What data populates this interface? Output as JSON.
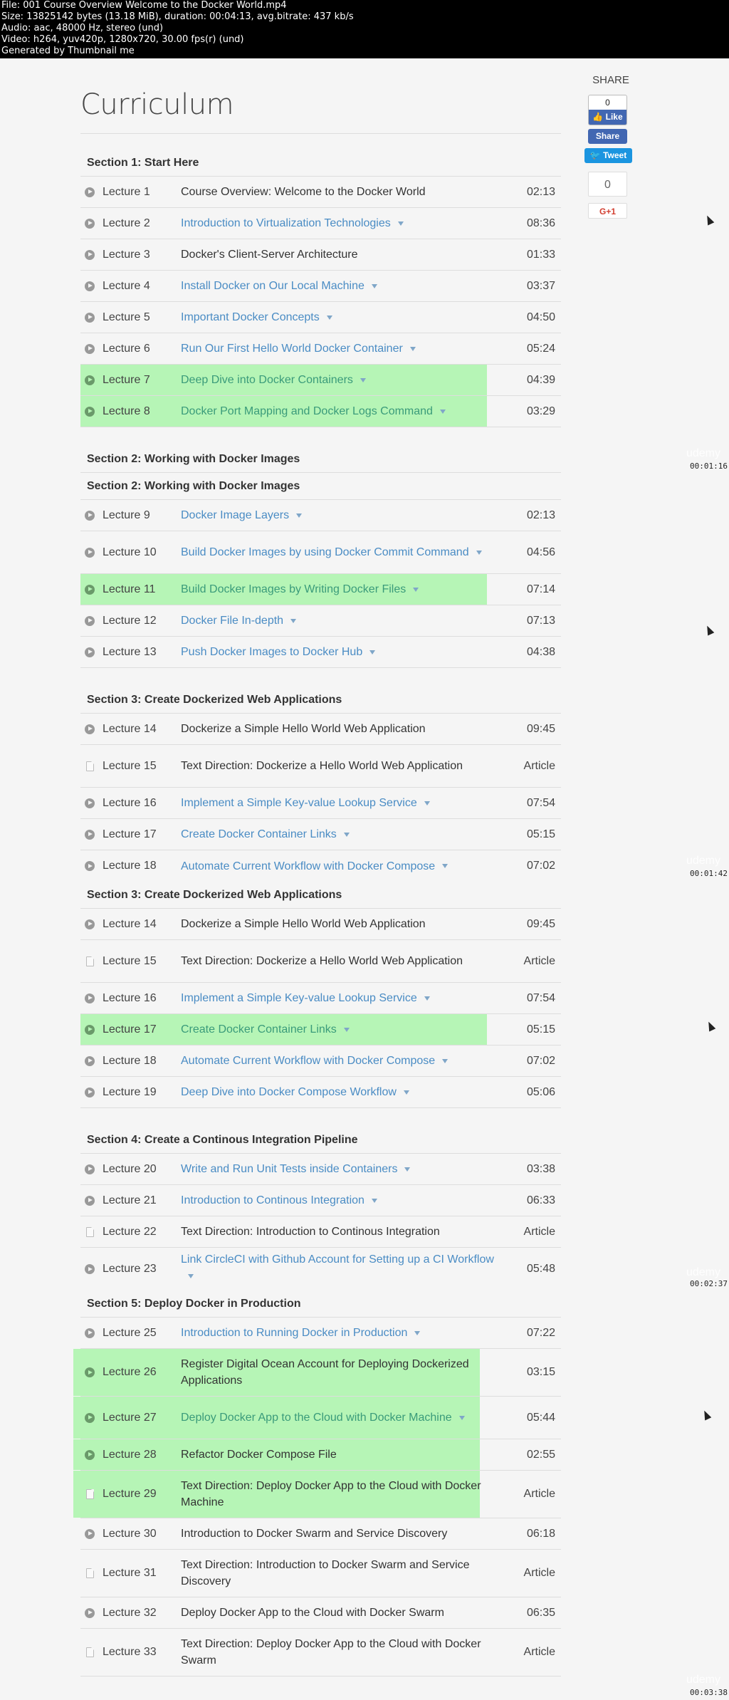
{
  "meta": {
    "lines": [
      "File: 001 Course Overview Welcome to the Docker World.mp4",
      "Size: 13825142 bytes (13.18 MiB), duration: 00:04:13, avg.bitrate: 437 kb/s",
      "Audio: aac, 48000 Hz, stereo (und)",
      "Video: h264, yuv420p, 1280x720, 30.00 fps(r) (und)",
      "Generated by Thumbnail me"
    ]
  },
  "title": "Curriculum",
  "share": {
    "label": "SHARE",
    "fb_count": "0",
    "fb_like": "Like",
    "fb_share": "Share",
    "tweet": "Tweet",
    "gplus_count": "0",
    "gplus": "G+1"
  },
  "colors": {
    "highlight": "#b6f5b6",
    "link": "#4a8cc4",
    "facebook": "#4267b2",
    "twitter": "#1b95e0",
    "gplus": "#d23f31"
  },
  "timestamps": [
    "00:01:16",
    "00:01:42",
    "00:02:37",
    "00:03:38"
  ],
  "watermark": "udemy",
  "blocks": [
    {
      "section": "Section 1: Start Here",
      "lectures": [
        {
          "num": "Lecture 1",
          "title": "Course Overview: Welcome to the Docker World",
          "dur": "02:13",
          "type": "video",
          "link": false,
          "hl": false
        },
        {
          "num": "Lecture 2",
          "title": "Introduction to Virtualization Technologies",
          "dur": "08:36",
          "type": "video",
          "link": true,
          "hl": false
        },
        {
          "num": "Lecture 3",
          "title": "Docker's Client-Server Architecture",
          "dur": "01:33",
          "type": "video",
          "link": false,
          "hl": false
        },
        {
          "num": "Lecture 4",
          "title": "Install Docker on Our Local Machine",
          "dur": "03:37",
          "type": "video",
          "link": true,
          "hl": false
        },
        {
          "num": "Lecture 5",
          "title": "Important Docker Concepts",
          "dur": "04:50",
          "type": "video",
          "link": true,
          "hl": false
        },
        {
          "num": "Lecture 6",
          "title": "Run Our First Hello World Docker Container",
          "dur": "05:24",
          "type": "video",
          "link": true,
          "hl": false
        },
        {
          "num": "Lecture 7",
          "title": "Deep Dive into Docker Containers",
          "dur": "04:39",
          "type": "video",
          "link": true,
          "hl": true
        },
        {
          "num": "Lecture 8",
          "title": "Docker Port Mapping and Docker Logs Command",
          "dur": "03:29",
          "type": "video",
          "link": true,
          "hl": true
        }
      ]
    },
    {
      "section": "Section 2: Working with Docker Images",
      "gap": true,
      "lectures": []
    },
    {
      "section": "Section 2: Working with Docker Images",
      "lectures": [
        {
          "num": "Lecture 9",
          "title": "Docker Image Layers",
          "dur": "02:13",
          "type": "video",
          "link": true,
          "hl": false
        },
        {
          "num": "Lecture 10",
          "title": "Build Docker Images by using Docker Commit Command",
          "dur": "04:56",
          "type": "video",
          "link": true,
          "hl": false,
          "tall": true
        },
        {
          "num": "Lecture 11",
          "title": "Build Docker Images by Writing Docker Files",
          "dur": "07:14",
          "type": "video",
          "link": true,
          "hl": true
        },
        {
          "num": "Lecture 12",
          "title": "Docker File In-depth",
          "dur": "07:13",
          "type": "video",
          "link": true,
          "hl": false
        },
        {
          "num": "Lecture 13",
          "title": "Push Docker Images to Docker Hub",
          "dur": "04:38",
          "type": "video",
          "link": true,
          "hl": false
        }
      ]
    },
    {
      "section": "Section 3: Create Dockerized Web Applications",
      "gap": true,
      "lectures": [
        {
          "num": "Lecture 14",
          "title": "Dockerize a Simple Hello World Web Application",
          "dur": "09:45",
          "type": "video",
          "link": false,
          "hl": false
        },
        {
          "num": "Lecture 15",
          "title": "Text Direction: Dockerize a Hello World Web Application",
          "dur": "Article",
          "type": "article",
          "link": false,
          "hl": false,
          "tall": true
        },
        {
          "num": "Lecture 16",
          "title": "Implement a Simple Key-value Lookup Service",
          "dur": "07:54",
          "type": "video",
          "link": true,
          "hl": false
        },
        {
          "num": "Lecture 17",
          "title": "Create Docker Container Links",
          "dur": "05:15",
          "type": "video",
          "link": true,
          "hl": false
        },
        {
          "num": "Lecture 18",
          "title": "Automate Current Workflow with Docker Compose",
          "dur": "07:02",
          "type": "video",
          "link": true,
          "hl": false,
          "nob": true
        }
      ]
    },
    {
      "section": "Section 3: Create Dockerized Web Applications",
      "lectures": [
        {
          "num": "Lecture 14",
          "title": "Dockerize a Simple Hello World Web Application",
          "dur": "09:45",
          "type": "video",
          "link": false,
          "hl": false
        },
        {
          "num": "Lecture 15",
          "title": "Text Direction: Dockerize a Hello World Web Application",
          "dur": "Article",
          "type": "article",
          "link": false,
          "hl": false,
          "tall": true
        },
        {
          "num": "Lecture 16",
          "title": "Implement a Simple Key-value Lookup Service",
          "dur": "07:54",
          "type": "video",
          "link": true,
          "hl": false
        },
        {
          "num": "Lecture 17",
          "title": "Create Docker Container Links",
          "dur": "05:15",
          "type": "video",
          "link": true,
          "hl": true
        },
        {
          "num": "Lecture 18",
          "title": "Automate Current Workflow with Docker Compose",
          "dur": "07:02",
          "type": "video",
          "link": true,
          "hl": false
        },
        {
          "num": "Lecture 19",
          "title": "Deep Dive into Docker Compose Workflow",
          "dur": "05:06",
          "type": "video",
          "link": true,
          "hl": false
        }
      ]
    },
    {
      "section": "Section 4: Create a Continous Integration Pipeline",
      "gap": true,
      "lectures": [
        {
          "num": "Lecture 20",
          "title": "Write and Run Unit Tests inside Containers",
          "dur": "03:38",
          "type": "video",
          "link": true,
          "hl": false
        },
        {
          "num": "Lecture 21",
          "title": "Introduction to Continous Integration",
          "dur": "06:33",
          "type": "video",
          "link": true,
          "hl": false
        },
        {
          "num": "Lecture 22",
          "title": "Text Direction: Introduction to Continous Integration",
          "dur": "Article",
          "type": "article",
          "link": false,
          "hl": false
        },
        {
          "num": "Lecture 23",
          "title": "Link CircleCI with Github Account for Setting up a CI Workflow",
          "dur": "05:48",
          "type": "video",
          "link": true,
          "hl": false,
          "tall": true,
          "nob": true
        }
      ]
    },
    {
      "section": "Section 5: Deploy Docker in Production",
      "lectures": [
        {
          "num": "Lecture 25",
          "title": "Introduction to Running Docker in Production",
          "dur": "07:22",
          "type": "video",
          "link": true,
          "hl": false
        },
        {
          "num": "Lecture 26",
          "title": "Register Digital Ocean Account for Deploying Dockerized Applications",
          "dur": "03:15",
          "type": "video",
          "link": false,
          "hl": true,
          "wide": true,
          "tall": true
        },
        {
          "num": "Lecture 27",
          "title": "Deploy Docker App to the Cloud with Docker Machine",
          "dur": "05:44",
          "type": "video",
          "link": true,
          "hl": true,
          "wide": true,
          "tall": true
        },
        {
          "num": "Lecture 28",
          "title": "Refactor Docker Compose File",
          "dur": "02:55",
          "type": "video",
          "link": false,
          "hl": true,
          "wide": true
        },
        {
          "num": "Lecture 29",
          "title": "Text Direction: Deploy Docker App to the Cloud with Docker Machine",
          "dur": "Article",
          "type": "article",
          "link": false,
          "hl": true,
          "wide": true,
          "tall": true
        },
        {
          "num": "Lecture 30",
          "title": "Introduction to Docker Swarm and Service Discovery",
          "dur": "06:18",
          "type": "video",
          "link": false,
          "hl": false
        },
        {
          "num": "Lecture 31",
          "title": "Text Direction: Introduction to Docker Swarm and Service Discovery",
          "dur": "Article",
          "type": "article",
          "link": false,
          "hl": false,
          "tall": true
        },
        {
          "num": "Lecture 32",
          "title": "Deploy Docker App to the Cloud with Docker Swarm",
          "dur": "06:35",
          "type": "video",
          "link": false,
          "hl": false
        },
        {
          "num": "Lecture 33",
          "title": "Text Direction: Deploy Docker App to the Cloud with Docker Swarm",
          "dur": "Article",
          "type": "article",
          "link": false,
          "hl": false,
          "tall": true
        }
      ]
    }
  ]
}
